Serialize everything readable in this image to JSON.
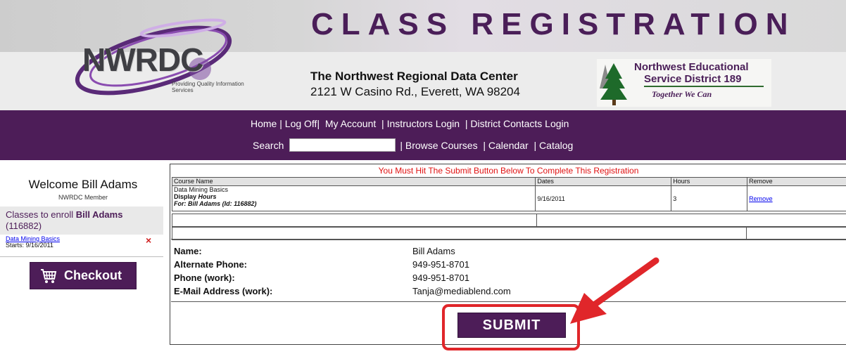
{
  "header": {
    "title": "CLASS REGISTRATION",
    "logo": {
      "text": "NWRDC",
      "tagline": "Providing Quality Information Services"
    },
    "org_name": "The Northwest Regional Data Center",
    "org_address": "2121 W Casino Rd., Everett, WA 98204",
    "partner": {
      "line1": "Northwest Educational",
      "line2": "Service District 189",
      "slogan": "Together We Can"
    }
  },
  "nav": {
    "row1": [
      "Home",
      "Log Off",
      "My Account",
      "Instructors Login",
      "District Contacts Login"
    ],
    "search_label": "Search",
    "search_value": "",
    "row2": [
      "Browse Courses",
      "Calendar",
      "Catalog"
    ]
  },
  "sidebar": {
    "welcome": "Welcome Bill Adams",
    "member": "NWRDC Member",
    "enroll_prefix": "Classes to enroll",
    "enroll_name": "Bill Adams",
    "enroll_id": "(116882)",
    "class_name": "Data Mining Basics",
    "class_starts": "Starts: 9/16/2011",
    "remove_x": "×",
    "checkout_label": "Checkout"
  },
  "main": {
    "notice": "You Must Hit The Submit Button Below To Complete This Registration",
    "columns": [
      "Course Name",
      "Dates",
      "Hours",
      "Remove"
    ],
    "row": {
      "course_name": "Data Mining Basics",
      "display_prefix": "Display",
      "display_value": "Hours",
      "for_line": "For: Bill Adams (Id: 116882)",
      "dates": "9/16/2011",
      "hours": "3",
      "remove": "Remove"
    },
    "contact": [
      {
        "label": "Name:",
        "value": "Bill Adams"
      },
      {
        "label": "Alternate Phone:",
        "value": "949-951-8701"
      },
      {
        "label": "Phone (work):",
        "value": "949-951-8701"
      },
      {
        "label": "E-Mail Address (work):",
        "value": "Tanja@mediablend.com"
      }
    ],
    "submit_label": "SUBMIT"
  },
  "colors": {
    "brand_purple": "#4d1d58",
    "notice_red": "#e01010",
    "highlight_red": "#e0262a"
  }
}
